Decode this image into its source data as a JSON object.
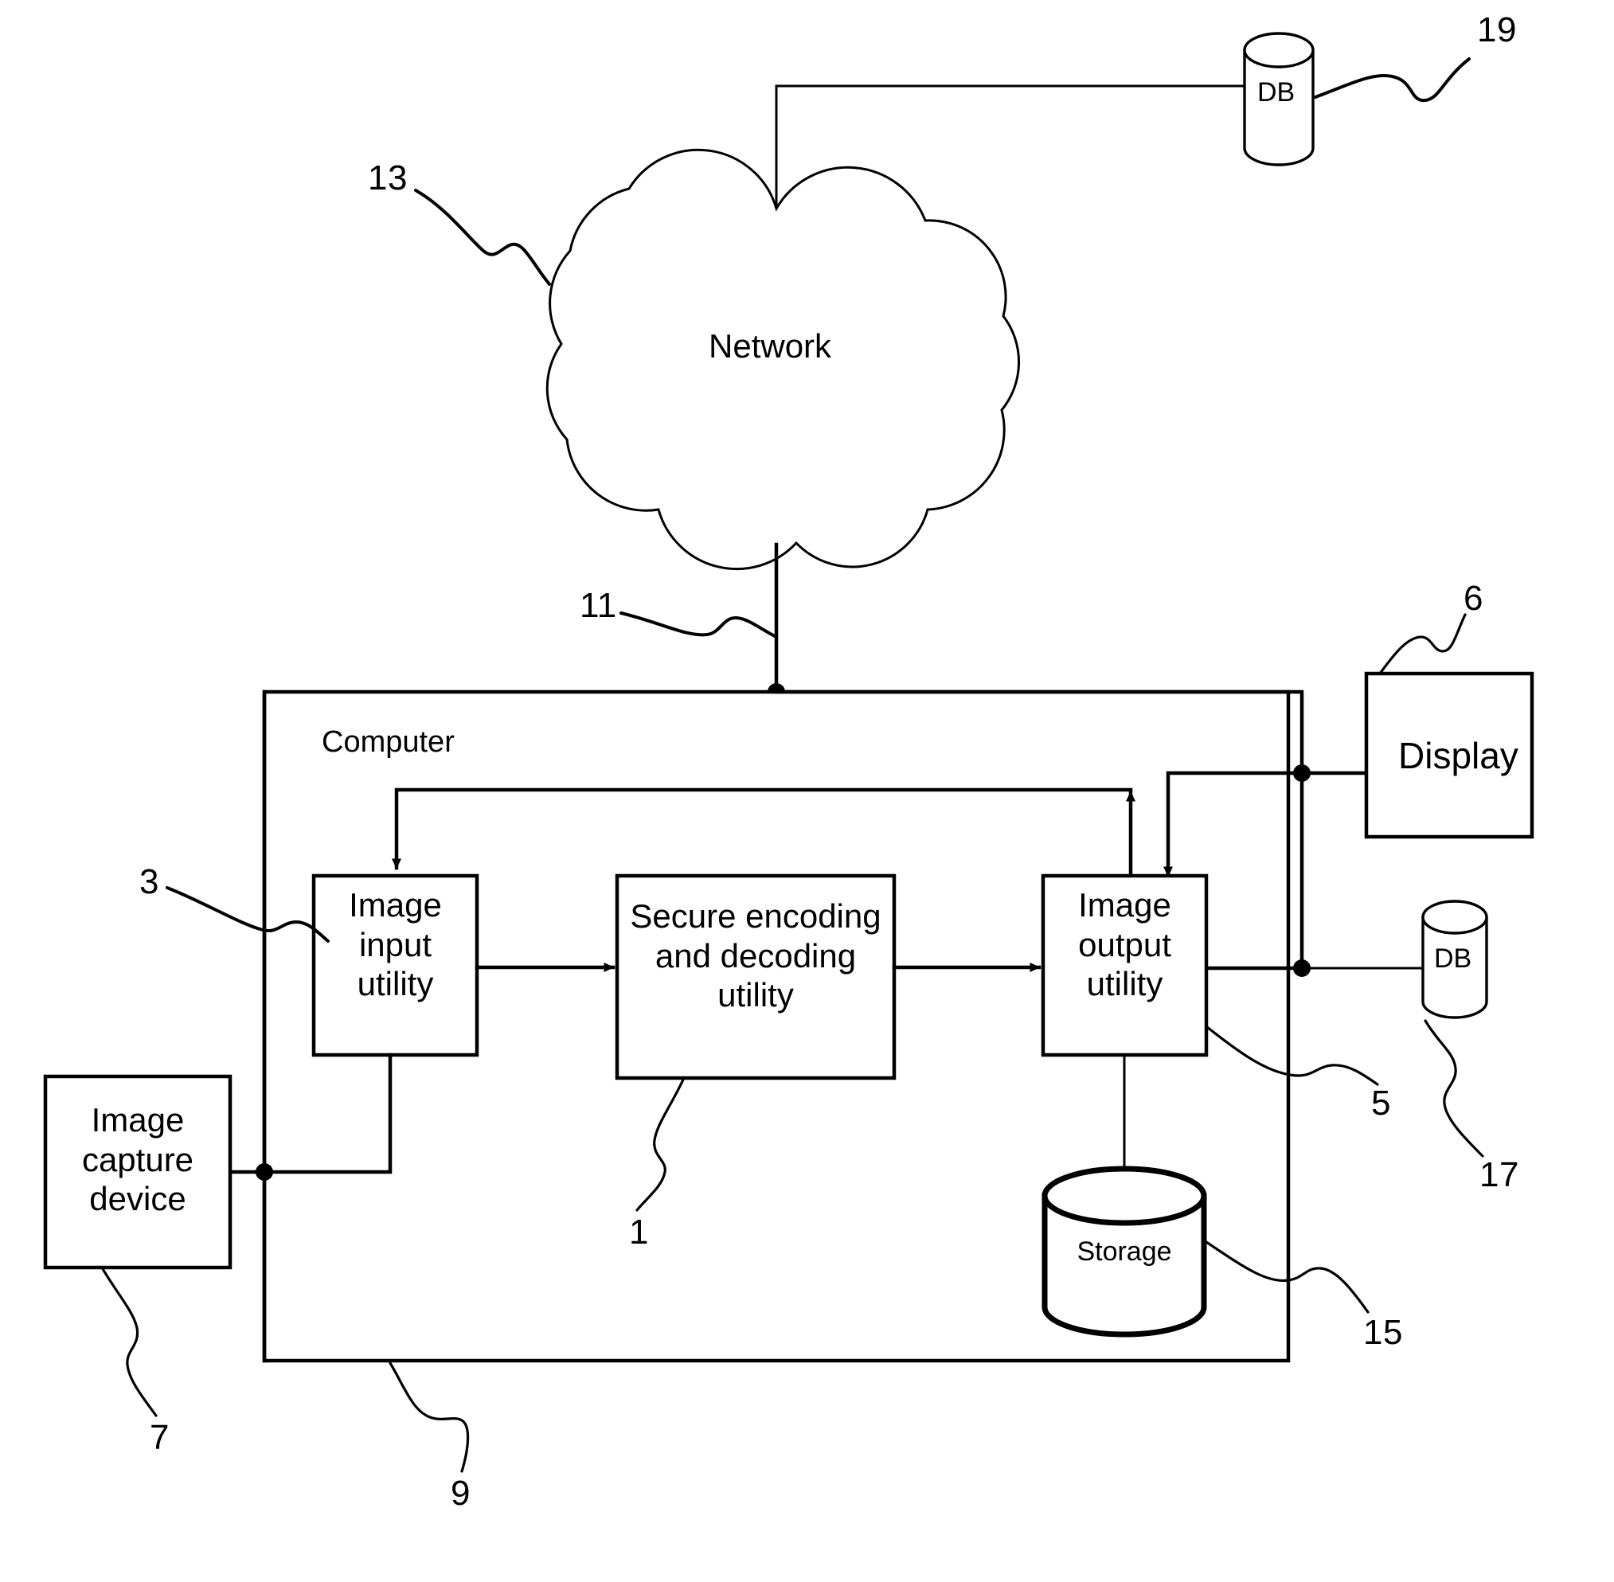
{
  "figure": {
    "title": "Secure image encoding and decoding system block diagram",
    "type": "patent-block-diagram",
    "background_color": "#ffffff",
    "line_color": "#000000"
  },
  "nodes": {
    "network_cloud": {
      "label": "Network",
      "shape": "cloud"
    },
    "db_top": {
      "label": "DB",
      "shape": "cylinder"
    },
    "db_right": {
      "label": "DB",
      "shape": "cylinder"
    },
    "computer": {
      "label": "Computer",
      "shape": "rectangle"
    },
    "image_input_utility": {
      "label": "Image\ninput\nutility",
      "shape": "rectangle"
    },
    "secure_codec_utility": {
      "label": "Secure encoding\nand decoding\nutility",
      "shape": "rectangle"
    },
    "image_output_utility": {
      "label": "Image\noutput\nutility",
      "shape": "rectangle"
    },
    "display": {
      "label": "Display",
      "shape": "rectangle"
    },
    "storage": {
      "label": "Storage",
      "shape": "cylinder"
    },
    "image_capture_device": {
      "label": "Image\ncapture\ndevice",
      "shape": "rectangle"
    }
  },
  "reference_numerals": [
    {
      "id": "ref-19",
      "value": "19",
      "refers_to": "db_top"
    },
    {
      "id": "ref-13",
      "value": "13",
      "refers_to": "network_cloud"
    },
    {
      "id": "ref-6",
      "value": "6",
      "refers_to": "display"
    },
    {
      "id": "ref-11",
      "value": "11",
      "refers_to": "network-computer-link"
    },
    {
      "id": "ref-3",
      "value": "3",
      "refers_to": "image_input_utility"
    },
    {
      "id": "ref-1",
      "value": "1",
      "refers_to": "secure_codec_utility"
    },
    {
      "id": "ref-5",
      "value": "5",
      "refers_to": "image_output_utility"
    },
    {
      "id": "ref-17",
      "value": "17",
      "refers_to": "db_right"
    },
    {
      "id": "ref-15",
      "value": "15",
      "refers_to": "storage"
    },
    {
      "id": "ref-7",
      "value": "7",
      "refers_to": "image_capture_device"
    },
    {
      "id": "ref-9",
      "value": "9",
      "refers_to": "computer"
    }
  ]
}
